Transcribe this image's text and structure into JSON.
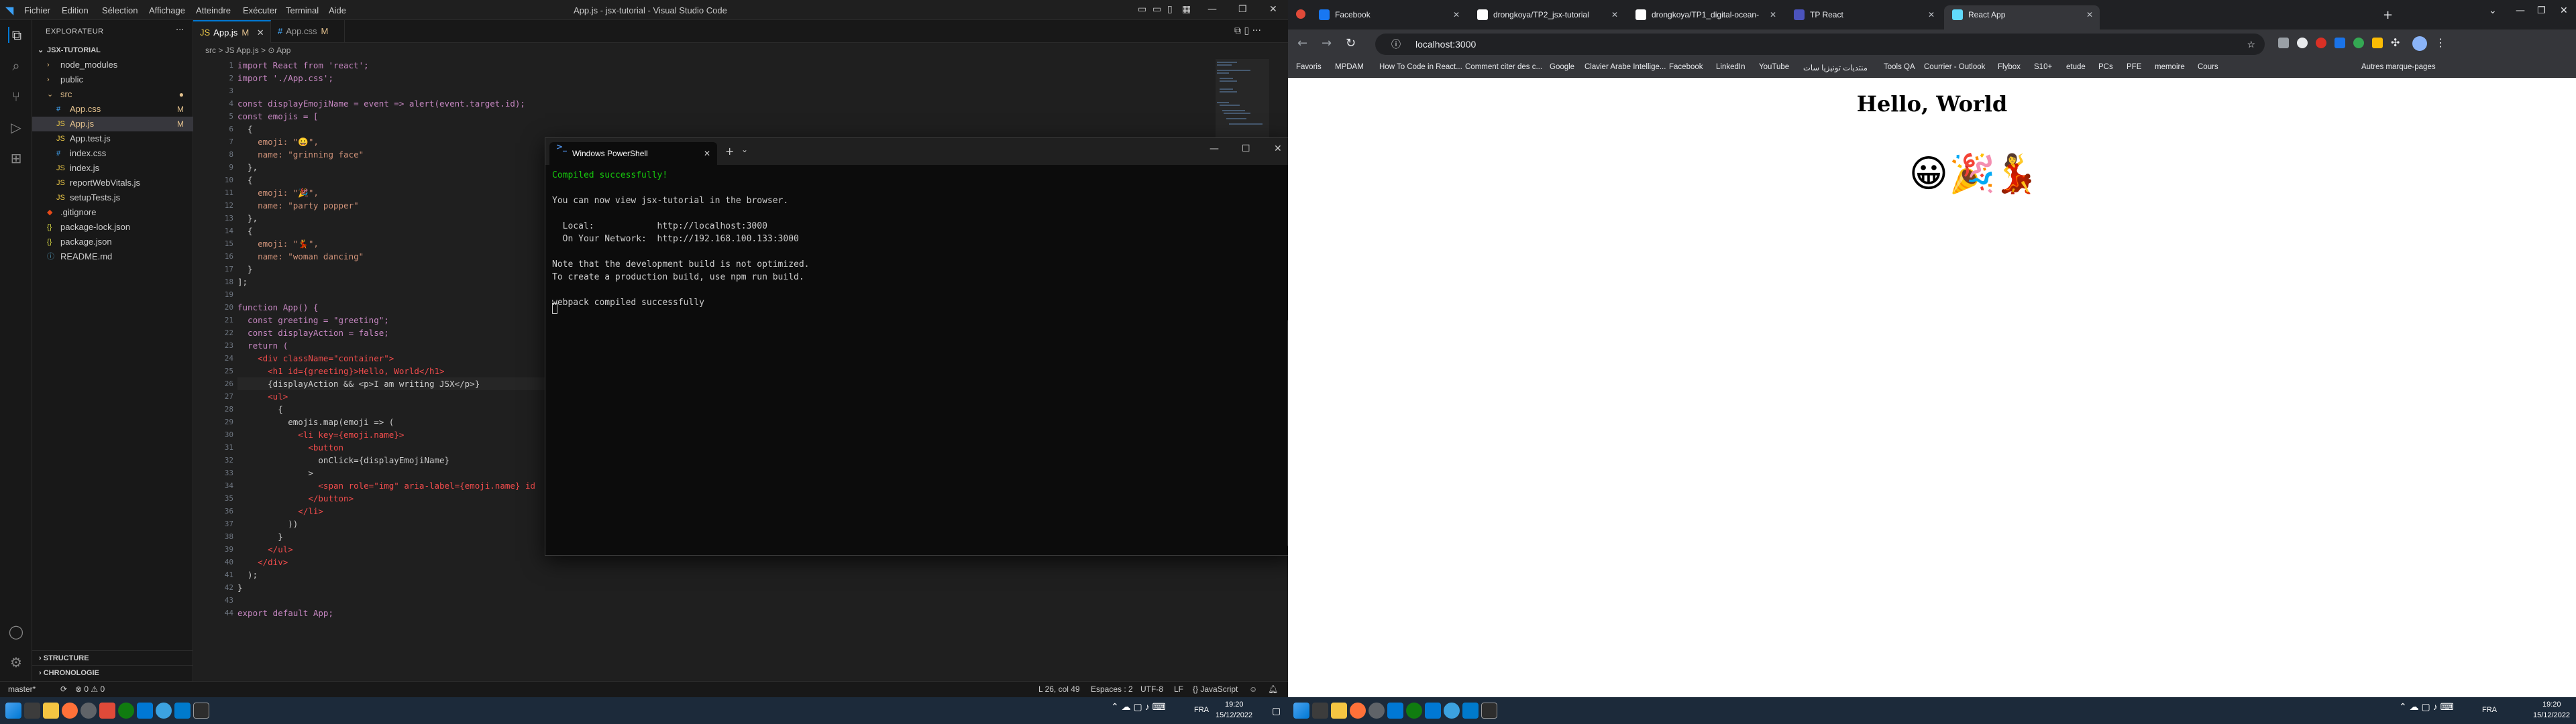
{
  "vscode": {
    "window_title": "App.js - jsx-tutorial - Visual Studio Code",
    "menu": [
      "Fichier",
      "Edition",
      "Sélection",
      "Affichage",
      "Atteindre",
      "Exécuter",
      "Terminal",
      "Aide"
    ],
    "explorer_title": "EXPLORATEUR",
    "project_name": "JSX-TUTORIAL",
    "files": [
      {
        "name": "node_modules",
        "kind": "folder",
        "depth": 0,
        "badge": ""
      },
      {
        "name": "public",
        "kind": "folder",
        "depth": 0,
        "badge": ""
      },
      {
        "name": "src",
        "kind": "folder-open",
        "depth": 0,
        "badge": "●"
      },
      {
        "name": "App.css",
        "kind": "css",
        "depth": 1,
        "badge": "M"
      },
      {
        "name": "App.js",
        "kind": "js",
        "depth": 1,
        "badge": "M"
      },
      {
        "name": "App.test.js",
        "kind": "js",
        "depth": 1,
        "badge": ""
      },
      {
        "name": "index.css",
        "kind": "css",
        "depth": 1,
        "badge": ""
      },
      {
        "name": "index.js",
        "kind": "js",
        "depth": 1,
        "badge": ""
      },
      {
        "name": "reportWebVitals.js",
        "kind": "js",
        "depth": 1,
        "badge": ""
      },
      {
        "name": "setupTests.js",
        "kind": "js",
        "depth": 1,
        "badge": ""
      },
      {
        "name": ".gitignore",
        "kind": "git",
        "depth": 0,
        "badge": ""
      },
      {
        "name": "package-lock.json",
        "kind": "json",
        "depth": 0,
        "badge": ""
      },
      {
        "name": "package.json",
        "kind": "json",
        "depth": 0,
        "badge": ""
      },
      {
        "name": "README.md",
        "kind": "md",
        "depth": 0,
        "badge": ""
      }
    ],
    "sections": [
      "STRUCTURE",
      "CHRONOLOGIE"
    ],
    "tabs": [
      {
        "label": "App.js",
        "mod": "M",
        "active": true,
        "type": "js"
      },
      {
        "label": "App.css",
        "mod": "M",
        "active": false,
        "type": "css"
      }
    ],
    "breadcrumb": "src > JS App.js > ⊙ App",
    "code_lines": [
      "import React from 'react';",
      "import './App.css';",
      "",
      "const displayEmojiName = event => alert(event.target.id);",
      "const emojis = [",
      "  {",
      "    emoji: \"😀\",",
      "    name: \"grinning face\"",
      "  },",
      "  {",
      "    emoji: \"🎉\",",
      "    name: \"party popper\"",
      "  },",
      "  {",
      "    emoji: \"💃\",",
      "    name: \"woman dancing\"",
      "  }",
      "];",
      "",
      "function App() {",
      "  const greeting = \"greeting\";",
      "  const displayAction = false;",
      "  return (",
      "    <div className=\"container\">",
      "      <h1 id={greeting}>Hello, World</h1>",
      "      {displayAction && <p>I am writing JSX</p>}",
      "      <ul>",
      "        {",
      "          emojis.map(emoji => (",
      "            <li key={emoji.name}>",
      "              <button",
      "                onClick={displayEmojiName}",
      "              >",
      "                <span role=\"img\" aria-label={emoji.name} id",
      "              </button>",
      "            </li>",
      "          ))",
      "        }",
      "      </ul>",
      "    </div>",
      "  );",
      "}",
      "",
      "export default App;"
    ],
    "status_left": [
      "master*",
      "⊗ 0 ⚠ 0"
    ],
    "status_right": [
      "L 26, col 49",
      "Espaces : 2",
      "UTF-8",
      "LF",
      "{} JavaScript"
    ]
  },
  "powershell": {
    "title": "Windows PowerShell",
    "lines": [
      {
        "text": "Compiled successfully!",
        "color": "#16c60c"
      },
      {
        "text": "",
        "color": "#cccccc"
      },
      {
        "text": "You can now view jsx-tutorial in the browser.",
        "color": "#cccccc"
      },
      {
        "text": "",
        "color": "#cccccc"
      },
      {
        "text": "  Local:            http://localhost:3000",
        "color": "#cccccc"
      },
      {
        "text": "  On Your Network:  http://192.168.100.133:3000",
        "color": "#cccccc"
      },
      {
        "text": "",
        "color": "#cccccc"
      },
      {
        "text": "Note that the development build is not optimized.",
        "color": "#cccccc"
      },
      {
        "text": "To create a production build, use npm run build.",
        "color": "#cccccc"
      },
      {
        "text": "",
        "color": "#cccccc"
      },
      {
        "text": "webpack compiled successfully",
        "color": "#cccccc"
      }
    ]
  },
  "chrome": {
    "tabs": [
      {
        "label": "Facebook",
        "active": false,
        "fav": "#1877f2"
      },
      {
        "label": "drongkoya/TP2_jsx-tutorial",
        "active": false,
        "fav": "#ffffff"
      },
      {
        "label": "drongkoya/TP1_digital-ocean-",
        "active": false,
        "fav": "#ffffff"
      },
      {
        "label": "TP React",
        "active": false,
        "fav": "#4b53bc"
      },
      {
        "label": "React App",
        "active": true,
        "fav": "#61dafb"
      }
    ],
    "url": "localhost:3000",
    "bookmarks": [
      "Favoris",
      "MPDAM",
      "How To Code in React...",
      "Comment citer des c...",
      "Google",
      "Clavier Arabe Intellige...",
      "Facebook",
      "LinkedIn",
      "YouTube",
      "منتديات تونيزيا سات",
      "Tools QA",
      "Courrier - Outlook",
      "Flybox",
      "S10+",
      "etude",
      "PCs",
      "PFE",
      "memoire",
      "Cours",
      "Autres marque-pages"
    ],
    "page": {
      "heading": "Hello, World",
      "emojis": [
        "😀",
        "🎉",
        "💃"
      ]
    }
  },
  "taskbar": {
    "lang": "FRA",
    "time": "19:20",
    "date": "15/12/2022"
  }
}
